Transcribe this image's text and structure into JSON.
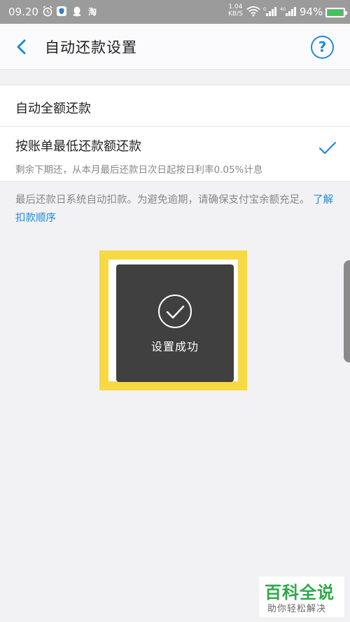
{
  "status_bar": {
    "time": "09.20",
    "net_speed_value": "1.04",
    "net_speed_unit": "KB/S",
    "battery_percent": "94%",
    "icons": [
      "alarm-icon",
      "shield-app-icon",
      "qq-penguin-icon",
      "taobao-icon",
      "wifi-icon",
      "signal-icon",
      "signal-4g-icon",
      "battery-icon"
    ]
  },
  "header": {
    "title": "自动还款设置",
    "help_label": "?"
  },
  "options": {
    "full_amount": "自动全额还款",
    "min_amount": "按账单最低还款额还款",
    "min_amount_desc": "剩余下期还，从本月最后还款日次日起按日利率0.05%计息",
    "selected": "min_amount"
  },
  "note": {
    "text": "最后还款日系统自动扣款。为避免逾期，请确保支付宝余额充足。",
    "link": "了解扣款顺序"
  },
  "toast": {
    "message": "设置成功"
  },
  "watermark": {
    "title": "百科全说",
    "subtitle": "助你轻松解决"
  },
  "colors": {
    "accent": "#1f8ad9",
    "highlight": "#f7d944",
    "toast_bg": "#404040",
    "watermark_green": "#2fa84a"
  }
}
